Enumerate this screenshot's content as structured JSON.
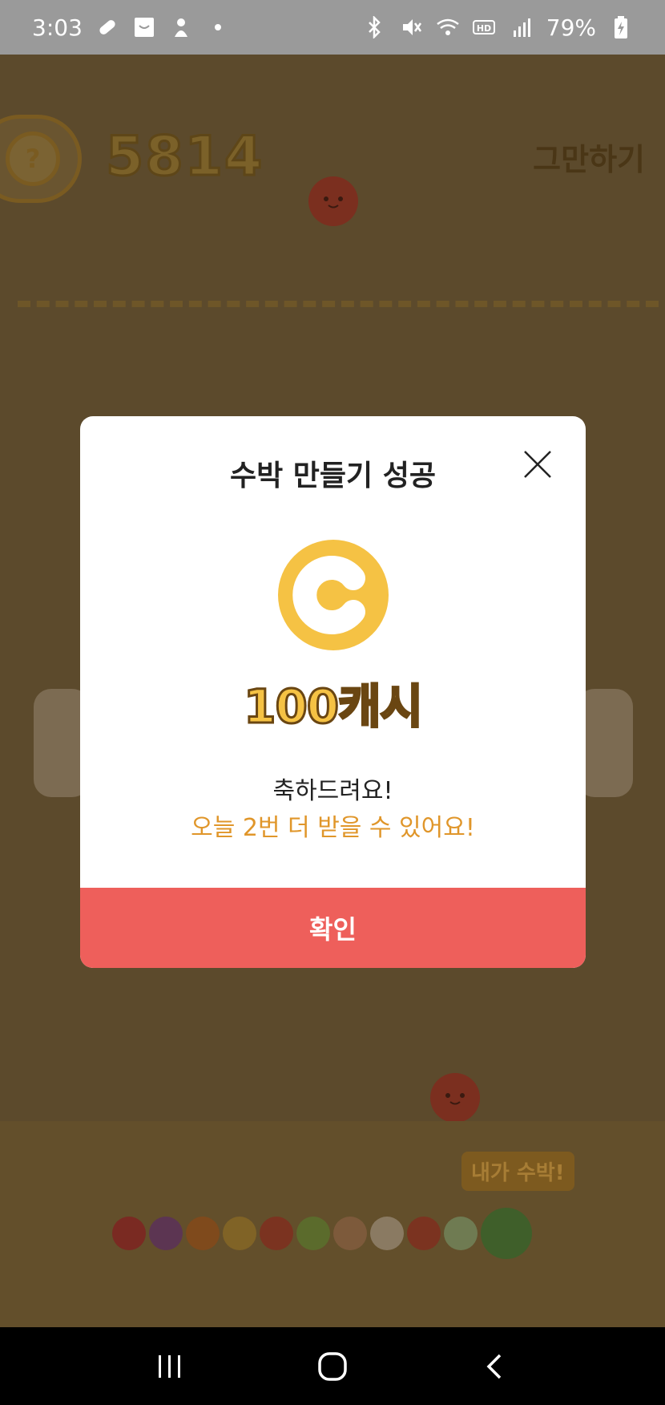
{
  "status_bar": {
    "time": "3:03",
    "battery": "79%",
    "left_icons": [
      "pill-icon",
      "store-icon",
      "character-icon",
      "dot-icon"
    ],
    "right_icons": [
      "bluetooth-icon",
      "mute-icon",
      "wifi-icon",
      "hd-icon",
      "signal-icon",
      "battery-icon"
    ]
  },
  "game": {
    "score": "5814",
    "quit_label": "그만하기",
    "help_symbol": "?",
    "evolution_label": "내가 수박!",
    "evolution_colors": [
      "#7a2a22",
      "#5c3552",
      "#7f4a1c",
      "#806326",
      "#7b3320",
      "#5b6b2c",
      "#7d5a3b",
      "#8a7a62",
      "#7b3320",
      "#6f7b52"
    ],
    "watermelon_color": "#3f5f2a"
  },
  "modal": {
    "title": "수박 만들기 성공",
    "reward": "100캐시",
    "coin_color": "#f5c244",
    "message": "축하드려요!",
    "remaining": "오늘 2번 더 받을 수 있어요!",
    "confirm_label": "확인",
    "accent_color": "#ee5f5b"
  },
  "nav_bar": {
    "buttons": [
      "recents-icon",
      "home-icon",
      "back-icon"
    ]
  }
}
